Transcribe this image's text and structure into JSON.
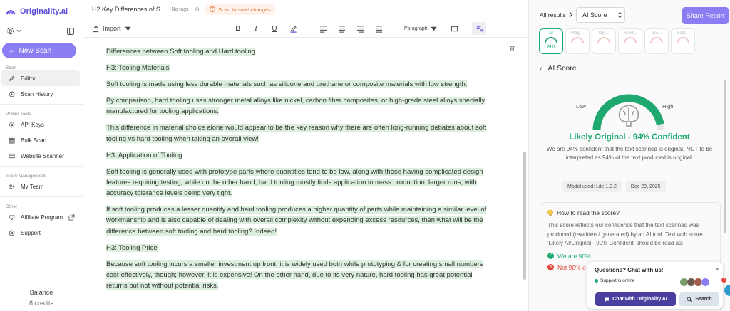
{
  "brand": {
    "name": "Originality.ai",
    "accent": "#8b7df2",
    "success": "#1fa96e",
    "danger": "#e0473d"
  },
  "sidebar": {
    "new_scan_label": "New Scan",
    "sections": [
      {
        "title": "Scan",
        "items": [
          {
            "label": "Editor",
            "icon": "pencil-icon",
            "active": true
          },
          {
            "label": "Scan History",
            "icon": "history-icon"
          }
        ]
      },
      {
        "title": "Power Tools",
        "items": [
          {
            "label": "API Keys",
            "icon": "key-icon"
          },
          {
            "label": "Bulk Scan",
            "icon": "stack-icon"
          },
          {
            "label": "Website Scanner",
            "icon": "monitor-icon"
          }
        ]
      },
      {
        "title": "Team Management",
        "items": [
          {
            "label": "My Team",
            "icon": "team-icon"
          }
        ]
      },
      {
        "title": "Other",
        "items": [
          {
            "label": "Affiliate Program",
            "icon": "heart-icon"
          },
          {
            "label": "Support",
            "icon": "support-icon"
          }
        ]
      }
    ],
    "balance_label": "Balance",
    "credits": "8 credits"
  },
  "editor": {
    "doc_title": "H2 Key Differences of S...",
    "no_tags": "No tags",
    "scan_warning": "Scan to save changes",
    "toolbar": {
      "import_label": "Import",
      "paragraph_label": "Paragraph"
    },
    "paragraphs": [
      "Differences between Soft tooling and Hard tooling",
      "H3: Tooling Materials",
      "Soft tooling is made using less durable materials such as silicone and urethane or composite materials with low strength.",
      "By comparison, hard tooling uses stronger metal alloys like nickel, carbon fiber composites, or high-grade steel alloys specially manufactured for tooling applications.",
      "This difference in material choice alone would appear to be the key reason why there are often long-running debates about soft tooling vs hard tooling when taking an overall view!",
      "H3: Application of Tooling",
      "Soft tooling is generally used with prototype parts where quantities tend to be low, along with those having complicated design features requiring testing; while on the other hand, hard tooling mostly finds application in mass production, larger runs, with accuracy tolerance levels being very tight.",
      "If soft tooling produces a lesser quantity and hard tooling produces a higher quantity of parts while maintaining a similar level of workmanship and is also capable of dealing with overall complexity without expending excess resources, then what will be the difference between soft tooling and hard tooling? Indeed!",
      "H3: Tooling Price",
      "Because soft tooling incurs a smaller investment up front, it is widely used both while prototyping & for creating small numbers cost-effectively, though; however, it is expensive! On the other hand, due to its very nature, hard tooling has great potential returns but not without potential risks."
    ]
  },
  "panel": {
    "all_results": "All results",
    "select_value": "AI Score",
    "share_label": "Share Report",
    "tabs": [
      {
        "label": "AI",
        "value": "94%",
        "active": true
      },
      {
        "label": "Plagi..."
      },
      {
        "label": "Opt..."
      },
      {
        "label": "Read..."
      },
      {
        "label": "Gra..."
      },
      {
        "label": "Fact..."
      }
    ],
    "header": "AI Score",
    "gauge": {
      "low": "Low",
      "high": "High",
      "fraction": 0.94
    },
    "verdict": "Likely Original - 94% Confident",
    "explanation": "We are 94% confident that the text scanned is original, NOT to be interpreted as 94% of the text produced is original.",
    "model": "Model used: Lite 1.0.2",
    "date": "Dec 29, 2025",
    "how_title": "How to read the score?",
    "how_text": "This score reflects our confidence that the text scanned was produced (rewritten / generated) by an AI tool. Text with score 'Likely AI/Original - 90% Confident' should be read as:",
    "result_good": "We are 90%",
    "result_bad": "Not 90% o"
  },
  "chat": {
    "title": "Questions? Chat with us!",
    "status": "Support is online",
    "badge": "2",
    "chat_label": "Chat with Originality.AI",
    "search_label": "Search"
  }
}
